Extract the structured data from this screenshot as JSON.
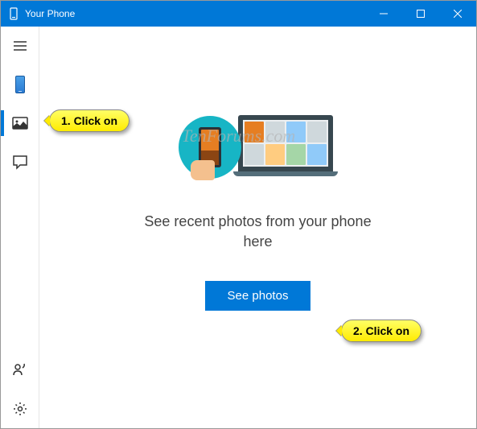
{
  "window": {
    "title": "Your Phone"
  },
  "sidebar": {
    "items": {
      "hamburger": "menu",
      "phone": "phone",
      "photos": "photos",
      "messages": "messages",
      "feedback": "feedback",
      "settings": "settings"
    }
  },
  "main": {
    "heading": "See recent photos from your phone here",
    "cta_label": "See photos"
  },
  "annotations": {
    "callout1": "1. Click on",
    "callout2": "2. Click on",
    "watermark": "TenForums.com"
  }
}
